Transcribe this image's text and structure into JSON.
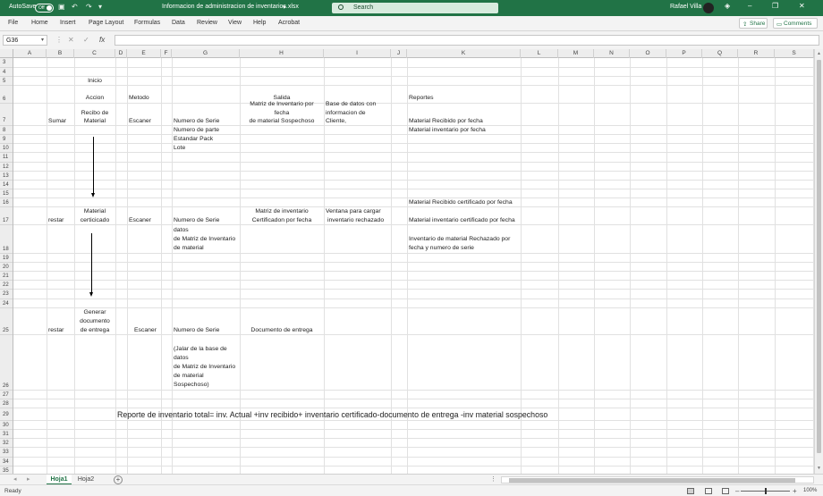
{
  "titlebar": {
    "autosave_label": "AutoSave",
    "autosave_state": "Off",
    "filename": "Informacion de administracion de inventarios.xlsx",
    "filename_suffix": "▾",
    "search_placeholder": "Search",
    "user_name": "Rafael Villa",
    "brand_color": "#217346"
  },
  "ribbon": {
    "tabs": [
      "File",
      "Home",
      "Insert",
      "Page Layout",
      "Formulas",
      "Data",
      "Review",
      "View",
      "Help",
      "Acrobat"
    ],
    "share_label": "Share",
    "comments_label": "Comments"
  },
  "formula_bar": {
    "name_box": "G36",
    "fx_label": "fx",
    "formula": ""
  },
  "grid": {
    "columns": [
      "A",
      "B",
      "C",
      "D",
      "E",
      "F",
      "G",
      "H",
      "I",
      "J",
      "K",
      "L",
      "M",
      "N",
      "O",
      "P",
      "Q",
      "R",
      "S"
    ],
    "rows": [
      "3",
      "4",
      "5",
      "6",
      "7",
      "8",
      "9",
      "10",
      "11",
      "12",
      "13",
      "14",
      "15",
      "16",
      "17",
      "18",
      "19",
      "20",
      "21",
      "22",
      "23",
      "24",
      "25",
      "26",
      "27",
      "28",
      "29",
      "30",
      "31",
      "32",
      "33",
      "34",
      "35"
    ],
    "cells": {
      "C5": "Inicio",
      "C6": "Accion",
      "E6": "Metodo",
      "H6": "Salida",
      "K6": "Reportes",
      "B7": "Sumar",
      "C7a": "Recibo de",
      "C7b": "Material",
      "E7": "Escaner",
      "G7": "Numero de Serie",
      "H7a": "Matriz de Inventario por",
      "H7b": "fecha",
      "H7c": "de material Sospechoso",
      "I7a": "Base de datos con",
      "I7b": "informacion de",
      "I7c": "Cliente,",
      "K7": "Material Recibido por fecha",
      "G8": "Numero de parte",
      "K8": "Material inventario por fecha",
      "G9": "Estandar Pack",
      "G10": "Lote",
      "K16": "Material Recibido certificado por fecha",
      "B17": "restar",
      "C17a": "Material",
      "C17b": "certicicado",
      "E17": "Escaner",
      "G17": "Numero de Serie",
      "H17a": "Matriz de inventario",
      "H17b": "Certificadon por fecha",
      "I17a": "Ventana para cargar",
      "I17b": "inventario rechazado",
      "K17": "Material inventario certificado por fecha",
      "G18a": "datos",
      "G18b": "de Matriz de Inventario",
      "G18c": "de material",
      "K18a": "Inventario de material Rechazado por",
      "K18b": "fecha y numero de serie",
      "C25a": "Generar",
      "C25b": "documento",
      "C25c": "de entrega",
      "B25": "restar",
      "E25": "Escaner",
      "G25": "Numero de Serie",
      "H25": "Documento de entrega",
      "G26a": "(Jalar de la base de",
      "G26b": "datos",
      "G26c": "de Matriz de Inventario",
      "G26d": "de material",
      "G26e": "Sospechoso)",
      "D29": "Reporte de inventario total= inv. Actual +inv recibido+ inventario certificado-documento de entrega -inv material sospechoso"
    }
  },
  "sheets": {
    "tabs": [
      "Hoja1",
      "Hoja2"
    ],
    "active": "Hoja1"
  },
  "status": {
    "ready": "Ready",
    "zoom": "100%"
  }
}
